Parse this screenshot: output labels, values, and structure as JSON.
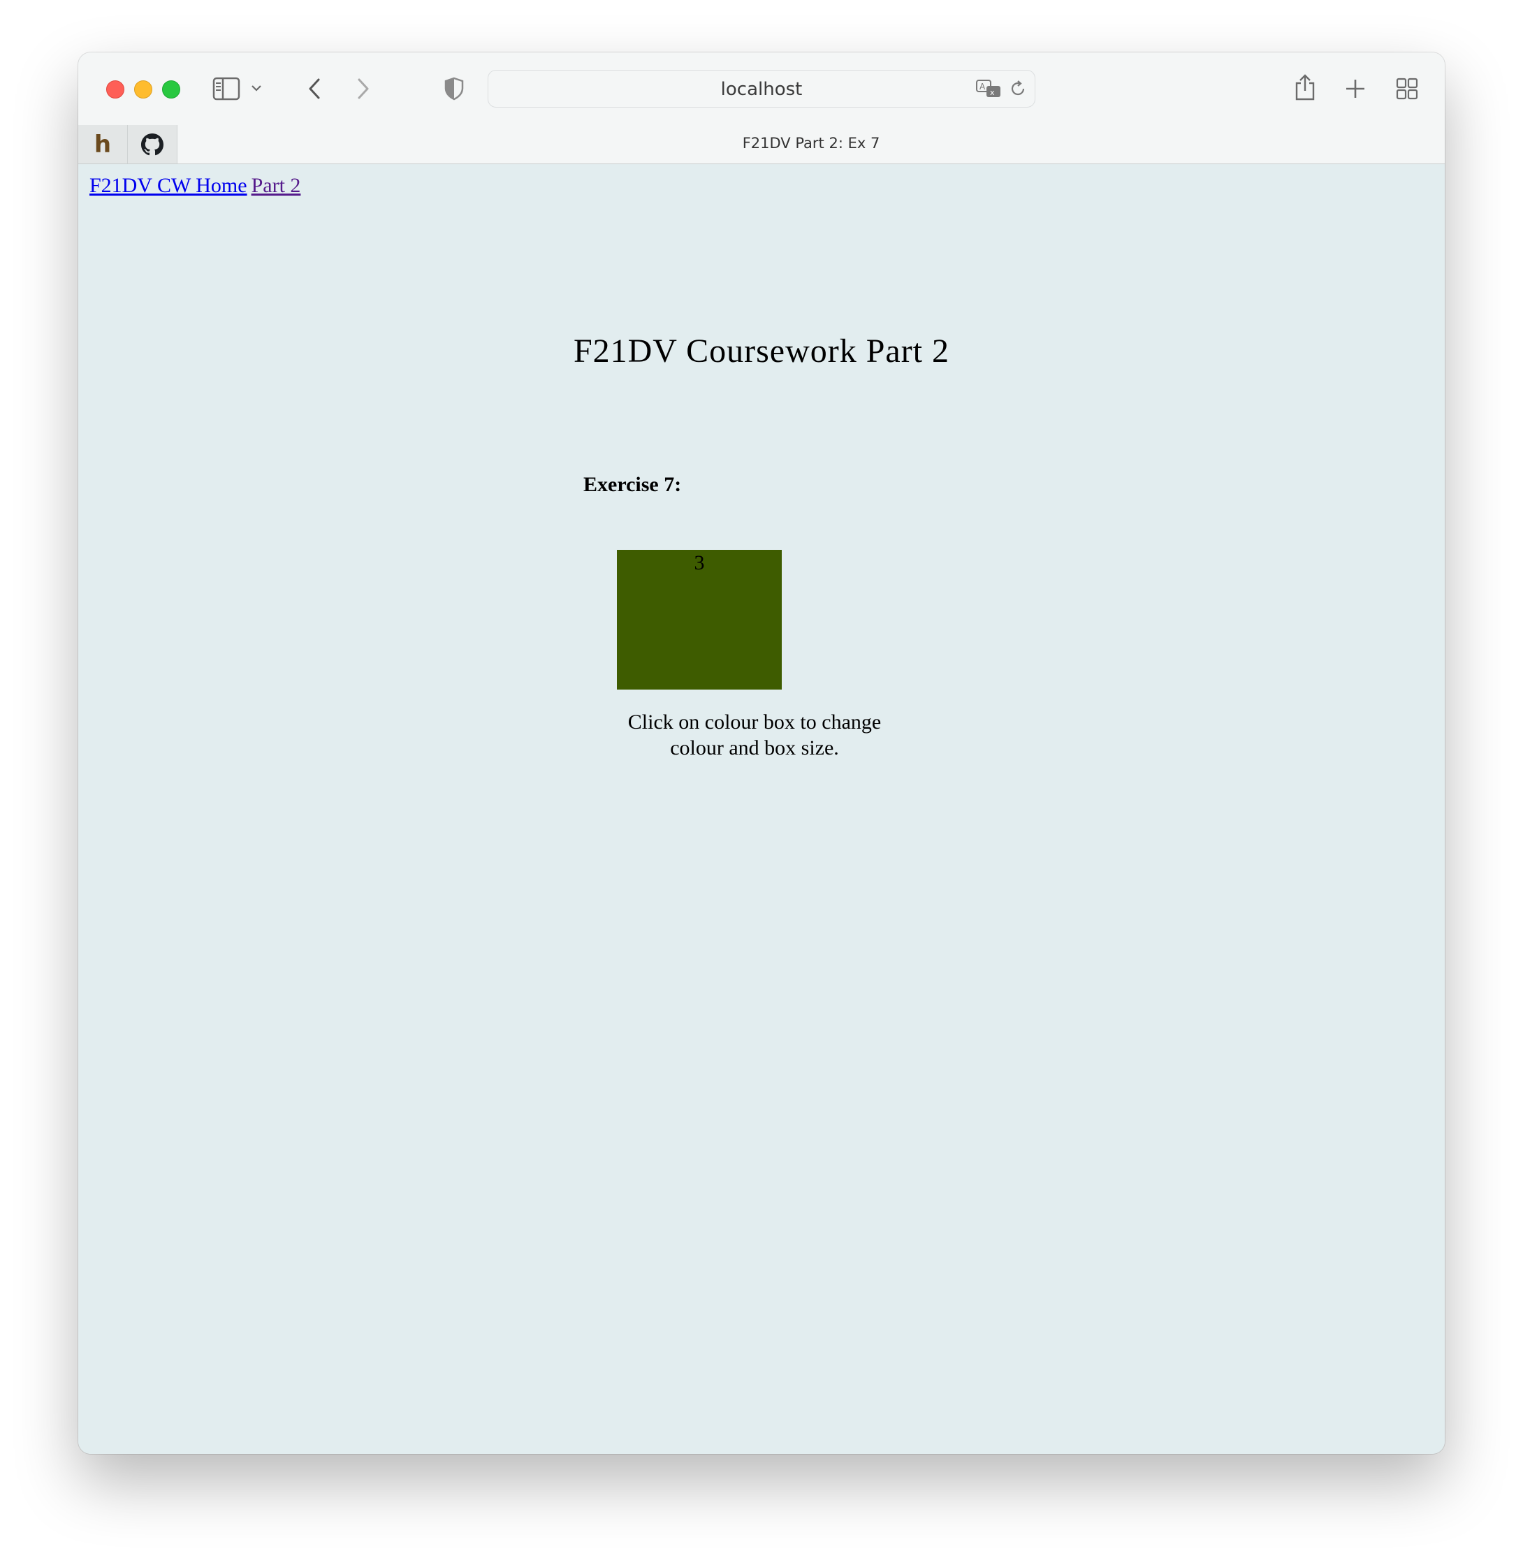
{
  "browser": {
    "url": "localhost",
    "tab_title": "F21DV Part 2: Ex 7",
    "favorites": [
      "h-icon",
      "github-icon"
    ]
  },
  "nav": {
    "home_link": "F21DV CW Home",
    "part_link": "Part 2"
  },
  "page": {
    "title": "F21DV Coursework Part 2",
    "exercise_label": "Exercise 7:",
    "box_value": "3",
    "box_color": "#3e5c00",
    "instructions": "Click on colour box to change colour and box size."
  }
}
